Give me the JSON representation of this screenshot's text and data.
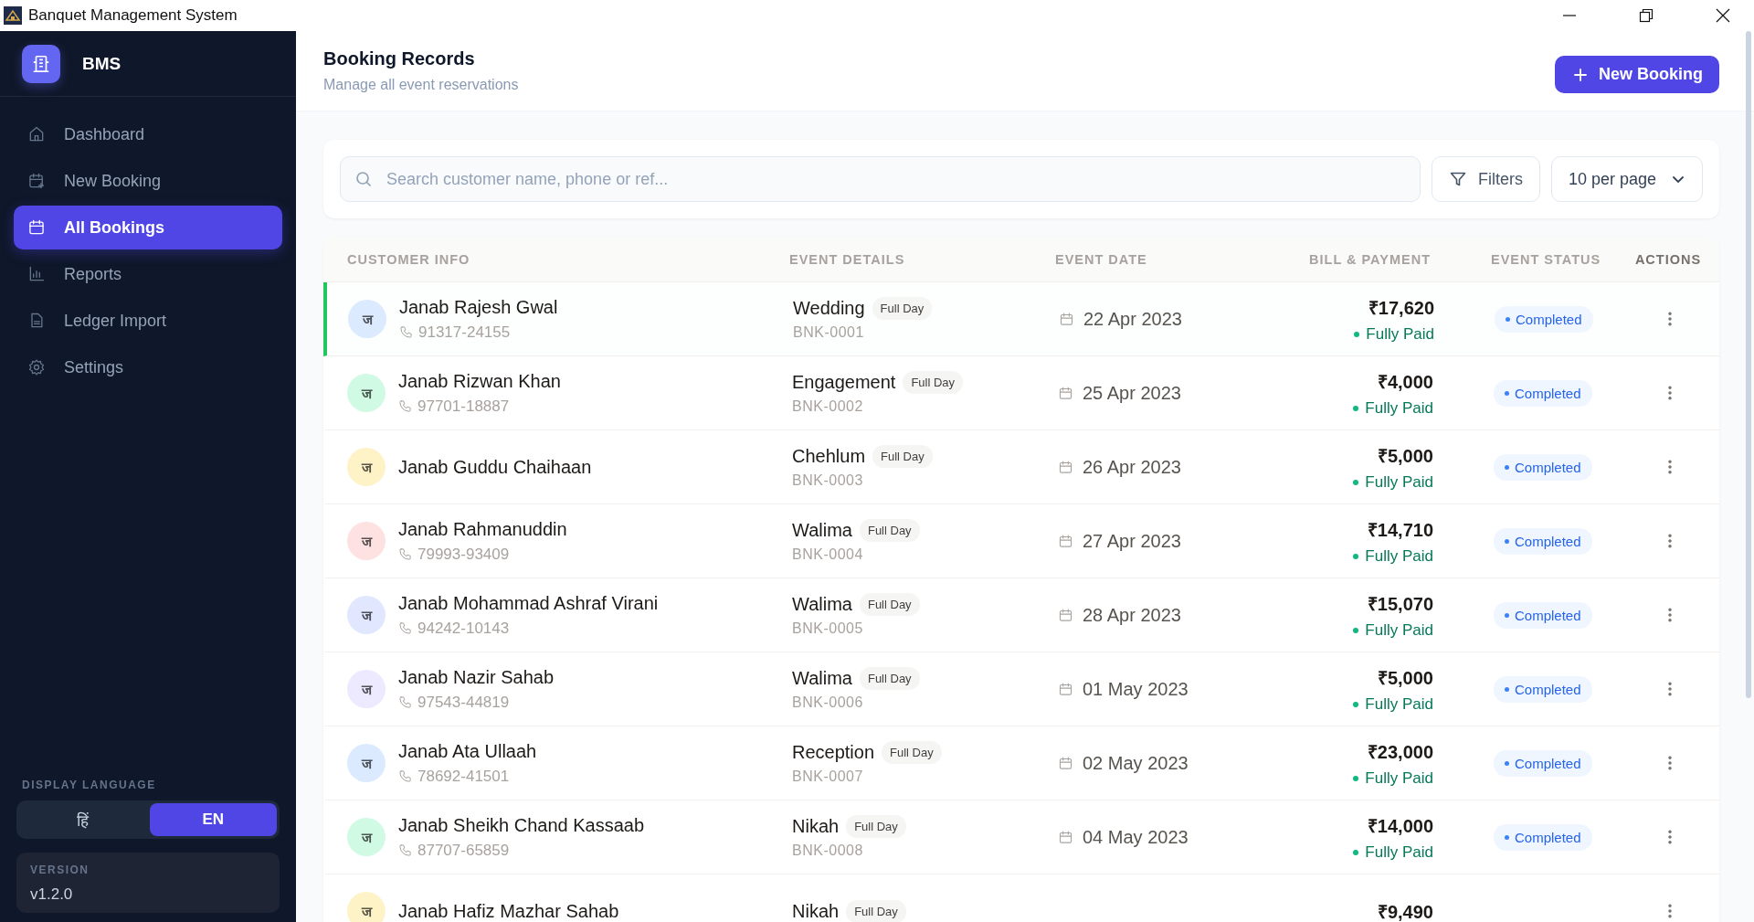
{
  "window": {
    "title": "Banquet Management System"
  },
  "sidebar": {
    "brand": "BMS",
    "items": [
      {
        "label": "Dashboard",
        "selected": false
      },
      {
        "label": "New Booking",
        "selected": false
      },
      {
        "label": "All Bookings",
        "selected": true
      },
      {
        "label": "Reports",
        "selected": false
      },
      {
        "label": "Ledger Import",
        "selected": false
      },
      {
        "label": "Settings",
        "selected": false
      }
    ],
    "language": {
      "label": "DISPLAY LANGUAGE",
      "options": [
        {
          "label": "हिं",
          "selected": false
        },
        {
          "label": "EN",
          "selected": true
        }
      ]
    },
    "version": {
      "label": "VERSION",
      "value": "v1.2.0"
    }
  },
  "header": {
    "title": "Booking Records",
    "subtitle": "Manage all event reservations",
    "button": "New Booking"
  },
  "toolbar": {
    "search": {
      "placeholder": "Search customer name, phone or ref..."
    },
    "filters": "Filters",
    "per_page": "10 per page"
  },
  "table": {
    "columns": [
      "CUSTOMER INFO",
      "EVENT DETAILS",
      "EVENT DATE",
      "BILL & PAYMENT",
      "EVENT STATUS",
      "ACTIONS"
    ],
    "rows": [
      {
        "selected": true,
        "avatar": "ज",
        "color": "#dbeafe",
        "name": "Janab Rajesh Gwal",
        "phone": "91317-24155",
        "event": "Wedding",
        "duration": "Full Day",
        "ref": "BNK-0001",
        "date": "22 Apr 2023",
        "amount": "₹17,620",
        "payment": "Fully Paid",
        "kind": "full",
        "status": "Completed"
      },
      {
        "selected": false,
        "avatar": "ज",
        "color": "#d1fae5",
        "name": "Janab Rizwan Khan",
        "phone": "97701-18887",
        "event": "Engagement",
        "duration": "Full Day",
        "ref": "BNK-0002",
        "date": "25 Apr 2023",
        "amount": "₹4,000",
        "payment": "Fully Paid",
        "kind": "full",
        "status": "Completed"
      },
      {
        "selected": false,
        "avatar": "ज",
        "color": "#fef3c7",
        "name": "Janab Guddu Chaihaan",
        "event": "Chehlum",
        "duration": "Full Day",
        "ref": "BNK-0003",
        "date": "26 Apr 2023",
        "amount": "₹5,000",
        "payment": "Fully Paid",
        "kind": "full",
        "status": "Completed"
      },
      {
        "selected": false,
        "avatar": "ज",
        "color": "#fee2e2",
        "name": "Janab Rahmanuddin",
        "phone": "79993-93409",
        "event": "Walima",
        "duration": "Full Day",
        "ref": "BNK-0004",
        "date": "27 Apr 2023",
        "amount": "₹14,710",
        "payment": "Fully Paid",
        "kind": "full",
        "status": "Completed"
      },
      {
        "selected": false,
        "avatar": "ज",
        "color": "#e0e7ff",
        "name": "Janab Mohammad Ashraf Virani",
        "phone": "94242-10143",
        "event": "Walima",
        "duration": "Full Day",
        "ref": "BNK-0005",
        "date": "28 Apr 2023",
        "amount": "₹15,070",
        "payment": "Fully Paid",
        "kind": "full",
        "status": "Completed"
      },
      {
        "selected": false,
        "avatar": "ज",
        "color": "#ede9fe",
        "name": "Janab Nazir Sahab",
        "phone": "97543-44819",
        "event": "Walima",
        "duration": "Full Day",
        "ref": "BNK-0006",
        "date": "01 May 2023",
        "amount": "₹5,000",
        "payment": "Fully Paid",
        "kind": "full",
        "status": "Completed"
      },
      {
        "selected": false,
        "avatar": "ज",
        "color": "#dbeafe",
        "name": "Janab Ata Ullaah",
        "phone": "78692-41501",
        "event": "Reception",
        "duration": "Full Day",
        "ref": "BNK-0007",
        "date": "02 May 2023",
        "amount": "₹23,000",
        "payment": "Fully Paid",
        "kind": "full",
        "status": "Completed"
      },
      {
        "selected": false,
        "avatar": "ज",
        "color": "#d1fae5",
        "name": "Janab Sheikh Chand Kassaab",
        "phone": "87707-65859",
        "event": "Nikah",
        "duration": "Full Day",
        "ref": "BNK-0008",
        "date": "04 May 2023",
        "amount": "₹14,000",
        "payment": "Fully Paid",
        "kind": "full",
        "status": "Completed"
      },
      {
        "selected": false,
        "avatar": "ज",
        "color": "#fef3c7",
        "name": "Janab Hafiz Mazhar Sahab",
        "event": "Nikah",
        "duration": "Full Day",
        "amount": "₹9,490"
      }
    ]
  }
}
